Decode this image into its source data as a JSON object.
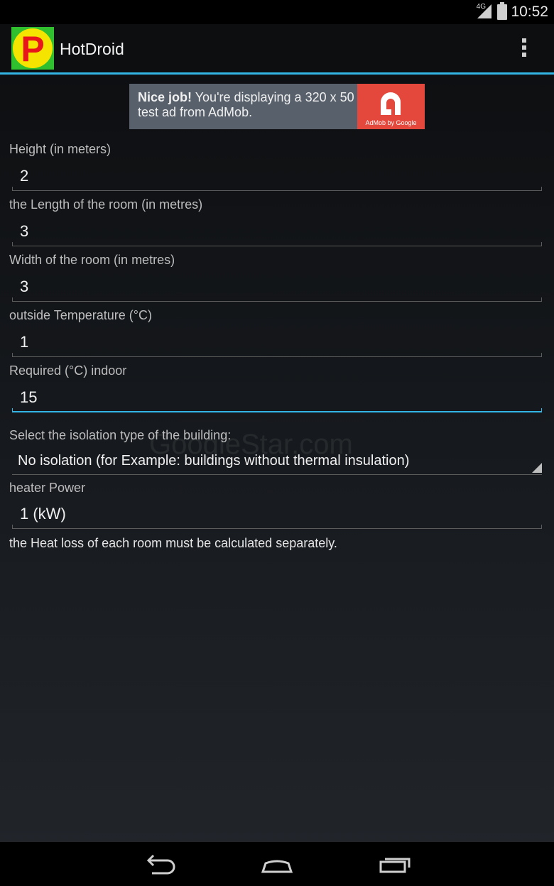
{
  "status_bar": {
    "network": "4G",
    "time": "10:52"
  },
  "action_bar": {
    "logo_letter": "P",
    "title": "HotDroid"
  },
  "ad": {
    "headline": "Nice job!",
    "message": " You're displaying a 320 x 50 test ad from AdMob.",
    "logo_text": "AdMob by Google"
  },
  "fields": [
    {
      "label": "Height (in meters)",
      "value": "2"
    },
    {
      "label": "the Length of the room (in metres)",
      "value": "3"
    },
    {
      "label": "Width of the room (in metres)",
      "value": "3"
    },
    {
      "label": "outside Temperature (°C)",
      "value": "1"
    },
    {
      "label": "Required (°C) indoor",
      "value": "15"
    }
  ],
  "isolation": {
    "label": "Select the isolation type of the building:",
    "selected": "No isolation (for Example: buildings without thermal insulation)"
  },
  "heater": {
    "label": "heater Power",
    "value": "1 (kW)"
  },
  "note": "the Heat loss of each room must be calculated separately.",
  "watermark": "GoogleStar.com"
}
